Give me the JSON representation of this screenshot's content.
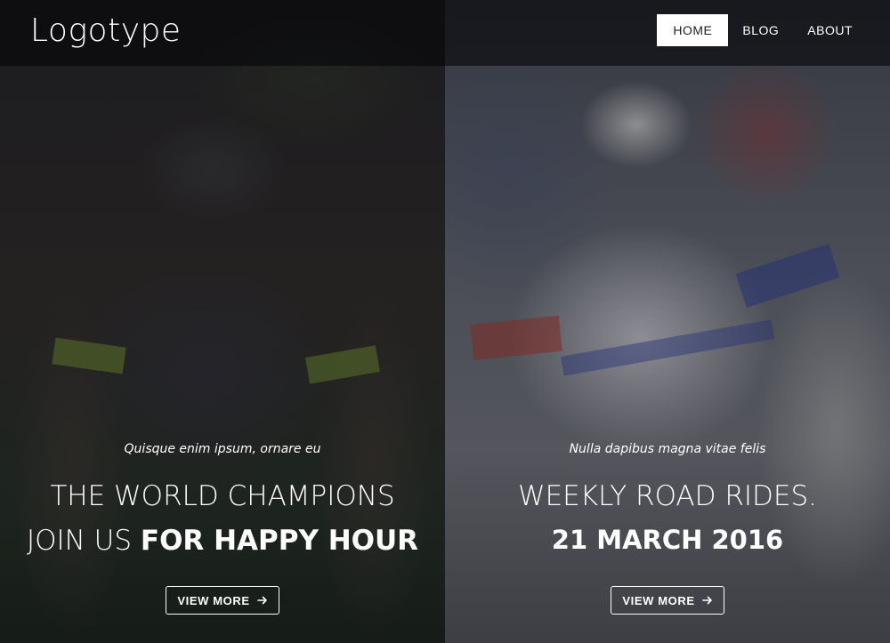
{
  "header": {
    "logo": "Logotype",
    "nav": [
      {
        "label": "HOME",
        "active": true
      },
      {
        "label": "BLOG",
        "active": false
      },
      {
        "label": "ABOUT",
        "active": false
      }
    ]
  },
  "slides": [
    {
      "subtitle": "Quisque enim ipsum, ornare eu",
      "headline_line1": "THE WORLD CHAMPIONS",
      "headline_line2_light": "JOIN US ",
      "headline_line2_bold": "FOR HAPPY HOUR",
      "button_label": "VIEW MORE",
      "button_icon": "arrow-right-icon"
    },
    {
      "subtitle": "Nulla dapibus magna vitae felis",
      "headline_line1": "WEEKLY ROAD RIDES.",
      "headline_line2_bold": "21 MARCH 2016",
      "button_label": "VIEW MORE",
      "button_icon": "arrow-right-icon"
    }
  ],
  "colors": {
    "header_bg": "#050508",
    "active_nav_bg": "#ffffff",
    "active_nav_text": "#222222",
    "text": "#ffffff"
  }
}
